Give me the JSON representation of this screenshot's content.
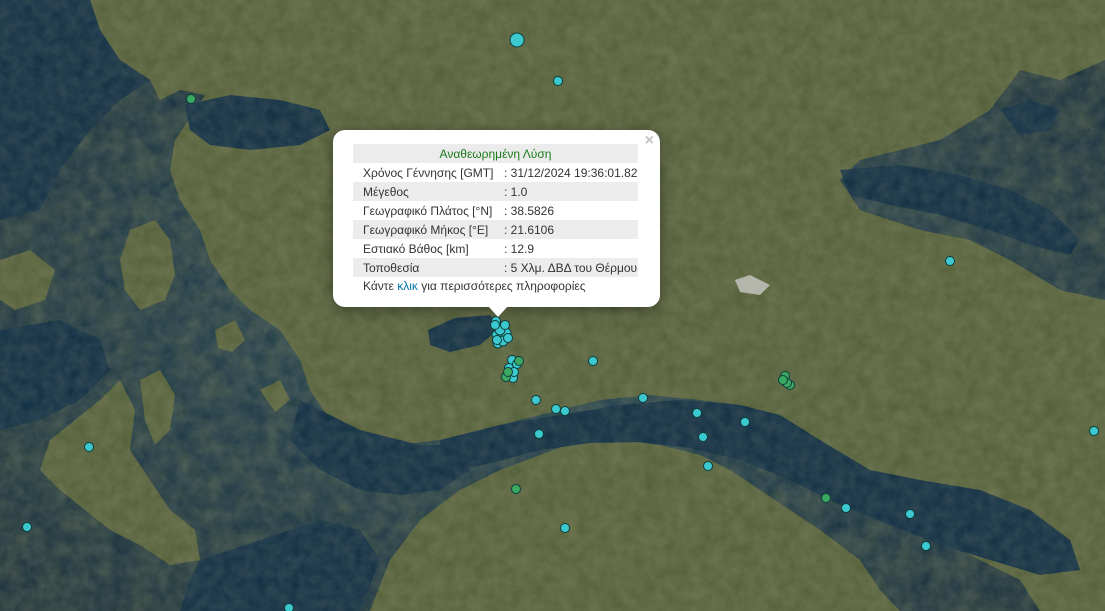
{
  "map": {
    "base_layer": "satellite",
    "colors": {
      "sea": "#0e2a3c",
      "land": "#4a5a34",
      "marker_cyan": "#3cc8cf",
      "marker_green": "#3aa860",
      "marker_border": "#0d3d3a"
    }
  },
  "popup": {
    "title": "Αναθεωρημένη Λύση",
    "rows": [
      {
        "label": "Χρόνος Γέννησης [GMT]",
        "value": ": 31/12/2024 19:36:01.82"
      },
      {
        "label": "Μέγεθος",
        "value": ": 1.0"
      },
      {
        "label": "Γεωγραφικό Πλάτος [°N]",
        "value": ": 38.5826"
      },
      {
        "label": "Γεωγραφικό Μήκος [°E]",
        "value": ": 21.6106"
      },
      {
        "label": "Εστιακό Βάθος [km]",
        "value": ": 12.9"
      },
      {
        "label": "Τοποθεσία",
        "value": ": 5 Χλμ. ΔΒΔ του Θέρμου"
      }
    ],
    "more_prefix": "Κάντε ",
    "more_link": "κλικ",
    "more_suffix": " για περισσότερες πληροφορίες",
    "close_symbol": "×"
  },
  "markers": {
    "cyan_count": 38,
    "green_count": 10
  }
}
